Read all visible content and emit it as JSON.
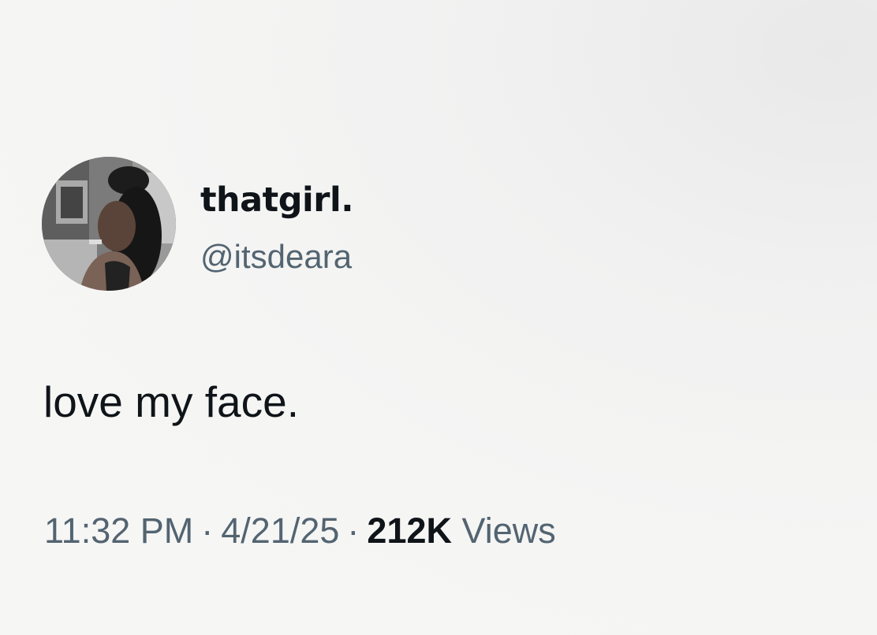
{
  "tweet": {
    "display_name": "thatgirl.",
    "handle": "@itsdeara",
    "text": "love my face.",
    "time": "11:32 PM",
    "separator": "·",
    "date": "4/21/25",
    "views_count": "212K",
    "views_label": "Views"
  },
  "colors": {
    "primary_text": "#0f1419",
    "secondary_text": "#536471",
    "background": "#f5f5f4"
  },
  "icons": {
    "avatar": "profile-photo"
  }
}
